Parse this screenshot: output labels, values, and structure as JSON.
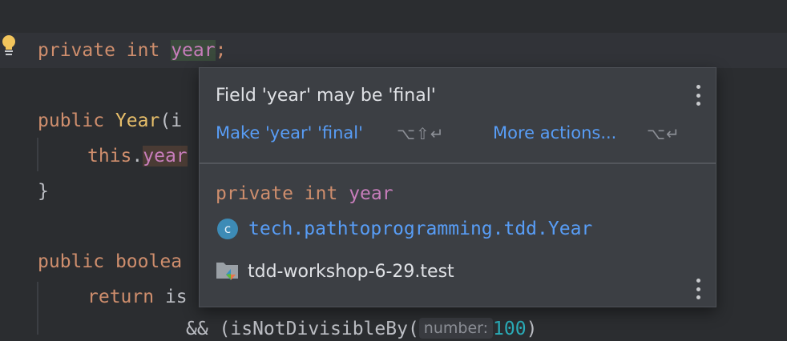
{
  "editor": {
    "line1": {
      "kw1": "private",
      "kw2": "int",
      "field": "year",
      "semi": ";"
    },
    "line2": {
      "kw": "public",
      "name": "Year",
      "rest": "(i"
    },
    "line3": {
      "kw": "this",
      "dot": ".",
      "field": "year"
    },
    "line4": {
      "text": "}"
    },
    "line5": {
      "kw": "public",
      "partial": "boolea"
    },
    "line6": {
      "kw": "return",
      "partial": "is"
    },
    "line7": {
      "prefix": "&& (isNotDivisibleBy(",
      "hint": "number:",
      "num": "100",
      "suffix": ")"
    }
  },
  "popup": {
    "title": "Field 'year' may be 'final'",
    "action_primary": "Make 'year' 'final'",
    "action_primary_shortcut": "⌥⇧↵",
    "action_more": "More actions...",
    "action_more_shortcut": "⌥↵",
    "declaration": {
      "kw1": "private",
      "kw2": "int",
      "field": "year"
    },
    "class_icon_letter": "c",
    "class_name": "tech.pathtoprogramming.tdd.Year",
    "module_name": "tdd-workshop-6-29.test"
  },
  "colors": {
    "editor_bg": "#2b2d30",
    "keyword": "#cf8e6d",
    "field": "#c77dbb",
    "link": "#589df6",
    "popup_bg": "#3c3f44",
    "bulb": "#f2c55c"
  },
  "icons": [
    "bulb-icon",
    "class-icon",
    "module-folder-icon",
    "more-options-icon"
  ]
}
